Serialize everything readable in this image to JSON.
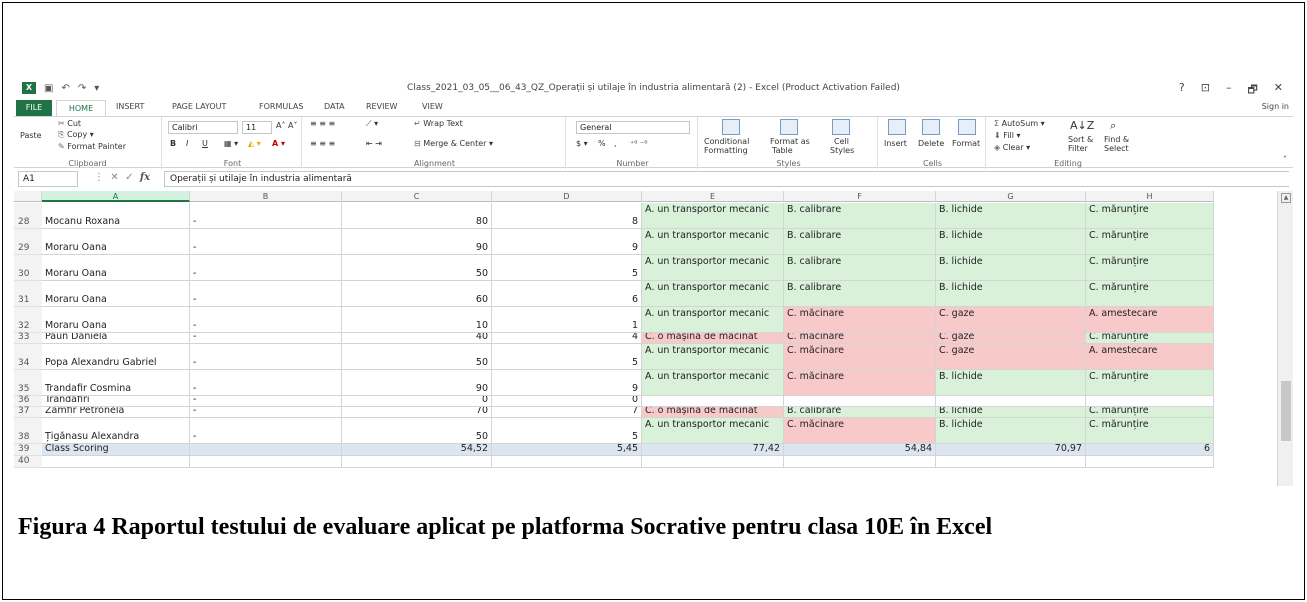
{
  "window": {
    "title": "Class_2021_03_05__06_43_QZ_Operații și utilaje în industria alimentară (2) - Excel (Product Activation Failed)",
    "help": "?",
    "controls": [
      "⊡",
      "–",
      "🗗",
      "✕"
    ]
  },
  "tabs": [
    "FILE",
    "HOME",
    "INSERT",
    "PAGE LAYOUT",
    "FORMULAS",
    "DATA",
    "REVIEW",
    "VIEW"
  ],
  "sign_in": "Sign in",
  "ribbon": {
    "clipboard": {
      "cut": "Cut",
      "copy": "Copy",
      "paste": "Paste",
      "format_painter": "Format Painter",
      "label": "Clipboard"
    },
    "font": {
      "name": "Calibri",
      "size": "11",
      "bold": "B",
      "italic": "I",
      "underline": "U",
      "label": "Font"
    },
    "alignment": {
      "wrap": "Wrap Text",
      "merge": "Merge & Center",
      "label": "Alignment"
    },
    "number": {
      "format": "General",
      "pct": "%",
      "comma": ",",
      "label": "Number"
    },
    "styles": {
      "conditional": "Conditional",
      "conditional2": "Formatting",
      "format_as": "Format as",
      "table": "Table",
      "cell": "Cell",
      "cell_styles": "Styles",
      "label": "Styles"
    },
    "cells": {
      "insert": "Insert",
      "delete": "Delete",
      "format": "Format",
      "label": "Cells"
    },
    "editing": {
      "autosum": "AutoSum",
      "fill": "Fill",
      "clear": "Clear",
      "sort": "Sort &",
      "filter": "Filter",
      "find": "Find &",
      "select": "Select",
      "label": "Editing"
    }
  },
  "formula_bar": {
    "name_box": "A1",
    "fx": "fx",
    "content": "Operații și utilaje în industria alimentară"
  },
  "columns": [
    "A",
    "B",
    "C",
    "D",
    "E",
    "F",
    "G",
    "H"
  ],
  "rows": [
    {
      "n": "28",
      "a": "Mocanu Roxana",
      "b": "-",
      "c": "80",
      "d": "8",
      "e": "A. un transportor mecanic",
      "f": "B. calibrare",
      "g": "B. lichide",
      "h": "C. mărunțire",
      "ec": "green",
      "fc": "green",
      "gc": "green",
      "hc": "green"
    },
    {
      "n": "29",
      "a": "Moraru Oana",
      "b": "-",
      "c": "90",
      "d": "9",
      "e": "A. un transportor mecanic",
      "f": "B. calibrare",
      "g": "B. lichide",
      "h": "C. mărunțire",
      "ec": "green",
      "fc": "green",
      "gc": "green",
      "hc": "green"
    },
    {
      "n": "30",
      "a": "Moraru Oana",
      "b": "-",
      "c": "50",
      "d": "5",
      "e": "A. un transportor mecanic",
      "f": "B. calibrare",
      "g": "B. lichide",
      "h": "C. mărunțire",
      "ec": "green",
      "fc": "green",
      "gc": "green",
      "hc": "green"
    },
    {
      "n": "31",
      "a": "Moraru Oana",
      "b": "-",
      "c": "60",
      "d": "6",
      "e": "A. un transportor mecanic",
      "f": "B. calibrare",
      "g": "B. lichide",
      "h": "C. mărunțire",
      "ec": "green",
      "fc": "green",
      "gc": "green",
      "hc": "green"
    },
    {
      "n": "32",
      "a": "Moraru Oana",
      "b": "-",
      "c": "10",
      "d": "1",
      "e": "A. un transportor mecanic",
      "f": "C. măcinare",
      "g": "C. gaze",
      "h": "A. amestecare",
      "ec": "green",
      "fc": "red",
      "gc": "red",
      "hc": "red"
    },
    {
      "n": "33",
      "a": "Paun Daniela",
      "b": "-",
      "c": "40",
      "d": "4",
      "e": "C. o mașină de măcinat",
      "f": "C. măcinare",
      "g": "C. gaze",
      "h": "C. mărunțire",
      "ec": "red",
      "fc": "red",
      "gc": "red",
      "hc": "green"
    },
    {
      "n": "34",
      "a": "Popa Alexandru Gabriel",
      "b": "-",
      "c": "50",
      "d": "5",
      "e": "A. un transportor mecanic",
      "f": "C. măcinare",
      "g": "C. gaze",
      "h": "A. amestecare",
      "ec": "green",
      "fc": "red",
      "gc": "red",
      "hc": "red"
    },
    {
      "n": "35",
      "a": "Trandafir Cosmina",
      "b": "-",
      "c": "90",
      "d": "9",
      "e": "A. un transportor mecanic",
      "f": "C. măcinare",
      "g": "B. lichide",
      "h": "C. mărunțire",
      "ec": "green",
      "fc": "red",
      "gc": "green",
      "hc": "green"
    },
    {
      "n": "36",
      "a": "Trandafiri",
      "b": "-",
      "c": "0",
      "d": "0",
      "e": "",
      "f": "",
      "g": "",
      "h": "",
      "ec": "",
      "fc": "",
      "gc": "",
      "hc": ""
    },
    {
      "n": "37",
      "a": "Zamfir Petronela",
      "b": "-",
      "c": "70",
      "d": "7",
      "e": "C. o mașină de măcinat",
      "f": "B. calibrare",
      "g": "B. lichide",
      "h": "C. mărunțire",
      "ec": "red",
      "fc": "green",
      "gc": "green",
      "hc": "green"
    },
    {
      "n": "38",
      "a": "Țigănasu Alexandra",
      "b": "-",
      "c": "50",
      "d": "5",
      "e": "A. un transportor mecanic",
      "f": "C. măcinare",
      "g": "B. lichide",
      "h": "C. mărunțire",
      "ec": "green",
      "fc": "red",
      "gc": "green",
      "hc": "green"
    },
    {
      "n": "39",
      "a": "Class Scoring",
      "b": "",
      "c": "54,52",
      "d": "5,45",
      "e": "77,42",
      "f": "54,84",
      "g": "70,97",
      "h": "6",
      "ec": "score",
      "fc": "score",
      "gc": "score",
      "hc": "score"
    },
    {
      "n": "40",
      "a": "",
      "b": "",
      "c": "",
      "d": "",
      "e": "",
      "f": "",
      "g": "",
      "h": "",
      "ec": "",
      "fc": "",
      "gc": "",
      "hc": ""
    }
  ],
  "caption": "Figura 4 Raportul testului de evaluare aplicat pe platforma Socrative pentru clasa 10E în Excel",
  "colors": {
    "correct": "#d9f0d9",
    "wrong": "#f8c9c9",
    "excel_green": "#217346"
  }
}
